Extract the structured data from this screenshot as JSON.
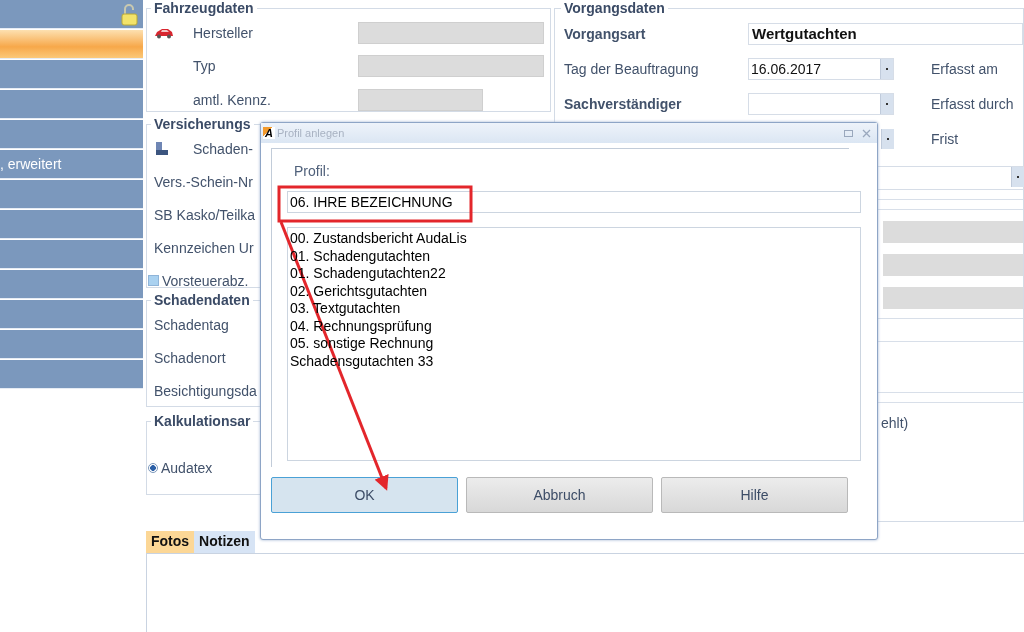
{
  "sidebar": {
    "items": [
      {
        "selected": false,
        "locked": true
      },
      {
        "selected": true
      },
      {
        "selected": false
      },
      {
        "selected": false
      },
      {
        "selected": false
      },
      {
        "selected": false,
        "label": ", erweitert"
      },
      {
        "selected": false
      },
      {
        "selected": false
      },
      {
        "selected": false
      },
      {
        "selected": false
      },
      {
        "selected": false
      },
      {
        "selected": false
      },
      {
        "selected": false
      }
    ]
  },
  "fahrzeugdaten": {
    "title": "Fahrzeugdaten",
    "fields": [
      {
        "label": "Hersteller",
        "kind": "icon"
      },
      {
        "label": "Typ",
        "kind": "plain"
      },
      {
        "label": "amtl. Kennz.",
        "kind": "plain"
      }
    ]
  },
  "versicherung": {
    "title": "Versicherungs",
    "fields": [
      {
        "label": "Schaden-",
        "kind": "icon"
      },
      {
        "label": "Vers.-Schein-Nr",
        "kind": "text"
      },
      {
        "label": "SB Kasko/Teilka",
        "kind": "text"
      },
      {
        "label": "Kennzeichen Ur",
        "kind": "text"
      },
      {
        "label": "Vorsteuerabz.",
        "kind": "checkbox",
        "checked": false
      }
    ]
  },
  "schadendaten": {
    "title": "Schadendaten",
    "fields": [
      "Schadentag",
      "Schadenort",
      "Besichtigungsda"
    ]
  },
  "kalkulation": {
    "title": "Kalkulationsar",
    "options": [
      {
        "label": "Audatex",
        "selected": true
      }
    ]
  },
  "vorgangsdaten": {
    "title": "Vorgangsdaten",
    "rows": [
      {
        "label": "Vorgangsart",
        "required": true,
        "kind": "text",
        "value": "Wertgutachten"
      },
      {
        "label": "Tag der Beauftragung",
        "required": false,
        "kind": "dropdown",
        "value": "16.06.2017",
        "side": "Erfasst am"
      },
      {
        "label": "Sachverständiger",
        "required": true,
        "kind": "dropdown",
        "side": "Erfasst durch"
      },
      {
        "kind": "button",
        "side": "Frist"
      }
    ],
    "fragment": "ehlt)"
  },
  "tabs": [
    {
      "label": "Fotos",
      "selected": true
    },
    {
      "label": "Notizen",
      "selected": false
    }
  ],
  "dialog": {
    "logo": "A",
    "title": "Profil anlegen",
    "label": "Profil:",
    "value": "06. IHRE BEZEICHNUNG",
    "items": [
      "00. Zustandsbericht AudaLis",
      "01. Schadengutachten",
      "01. Schadengutachten22",
      "02. Gerichtsgutachten",
      "03. Textgutachten",
      "04. Rechnungsprüfung",
      "05. sonstige Rechnung",
      "Schadensgutachten 33"
    ],
    "buttons": [
      {
        "label": "OK",
        "focused": true
      },
      {
        "label": "Abbruch",
        "focused": false
      },
      {
        "label": "Hilfe",
        "focused": false
      }
    ]
  }
}
